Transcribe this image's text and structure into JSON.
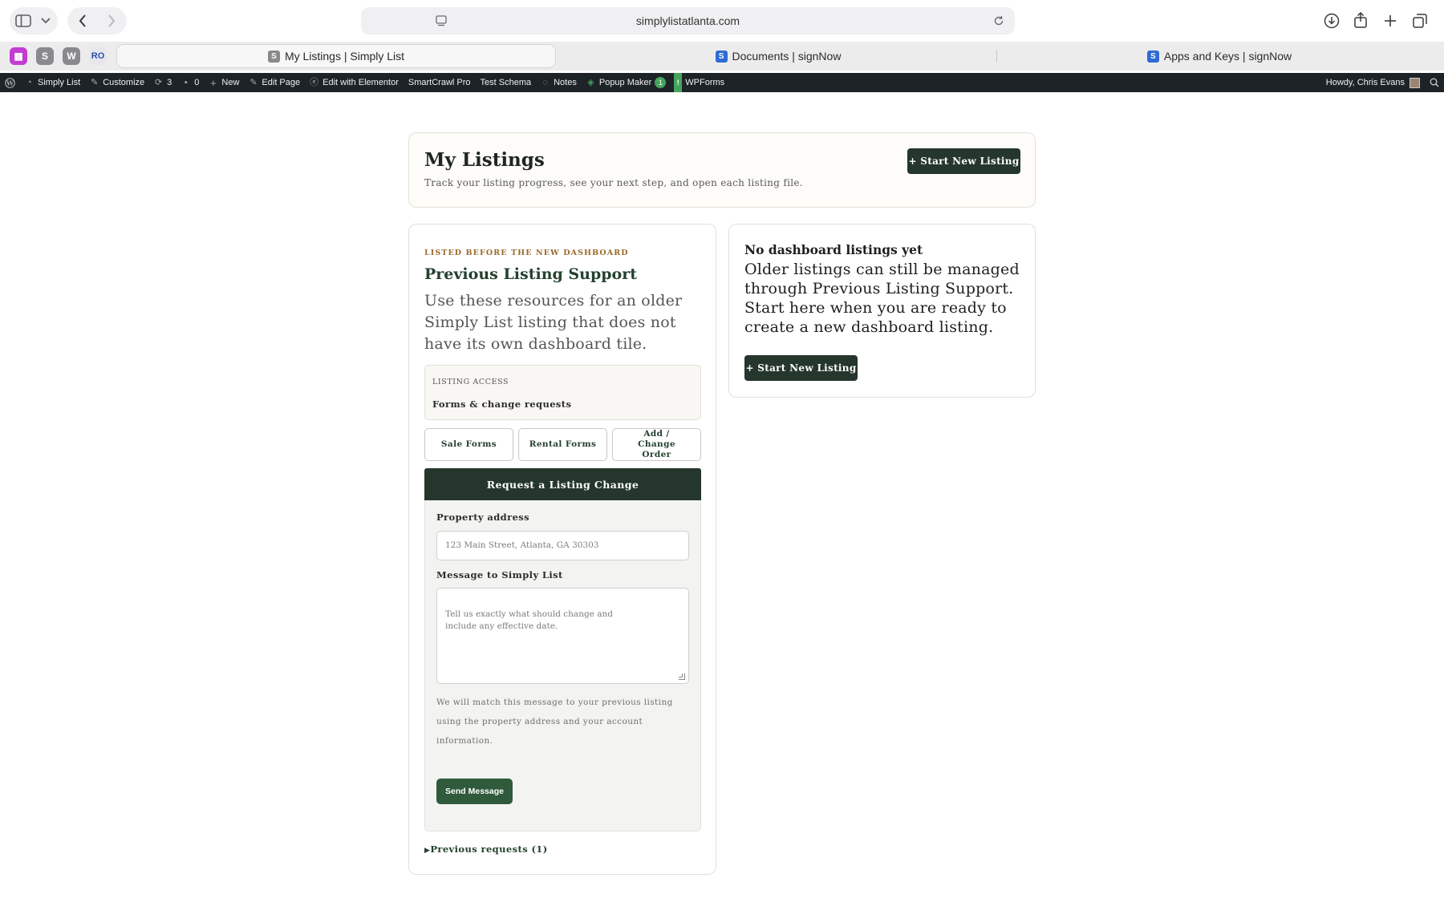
{
  "browser": {
    "url": "simplylistatlanta.com",
    "tabs": [
      {
        "label": "My Listings | Simply List",
        "favicon": "S",
        "active": true
      },
      {
        "label": "Documents | signNow",
        "favicon": "S",
        "active": false
      },
      {
        "label": "Apps and Keys | signNow",
        "favicon": "S",
        "active": false
      }
    ],
    "pinned": [
      "S",
      "W",
      "RO"
    ]
  },
  "adminbar": {
    "site_name": "Simply List",
    "customize": "Customize",
    "updates_count": "3",
    "comments_count": "0",
    "new": "New",
    "edit_page": "Edit Page",
    "edit_elementor": "Edit with Elementor",
    "smartcrawl": "SmartCrawl Pro",
    "test_schema": "Test Schema",
    "notes": "Notes",
    "popup_maker": "Popup Maker",
    "popup_badge": "1",
    "wpforms_badge": "!",
    "wpforms": "WPForms",
    "howdy": "Howdy, Chris Evans"
  },
  "header": {
    "title": "My Listings",
    "subtitle": "Track your listing progress, see your next step, and open each listing file.",
    "start_button": "+ Start New Listing"
  },
  "support": {
    "eyebrow": "LISTED BEFORE THE NEW DASHBOARD",
    "title": "Previous Listing Support",
    "description": "Use these resources for an older Simply List listing that does not have its own dashboard tile.",
    "access_label": "LISTING ACCESS",
    "access_value": "Forms & change requests",
    "buttons": {
      "sale": "Sale Forms",
      "rental": "Rental Forms",
      "change_order": "Add / Change Order"
    },
    "form": {
      "header": "Request a Listing Change",
      "address_label": "Property address",
      "address_placeholder": "123 Main Street, Atlanta, GA 30303",
      "message_label": "Message to Simply List",
      "message_placeholder": "Tell us exactly what should change and\ninclude any effective date.",
      "help_text": "We will match this message to your previous listing using the property address and your account information.",
      "send_button": "Send Message"
    },
    "previous_requests": "Previous requests (1)"
  },
  "empty_state": {
    "title": "No dashboard listings yet",
    "description": "Older listings can still be managed through Previous Listing Support. Start here when you are ready to create a new dashboard listing.",
    "button": "+ Start New Listing"
  },
  "colors": {
    "brand_dark": "#25362c",
    "brand_green": "#2f5a3c",
    "eyebrow": "#9a6a2a",
    "adminbar": "#1d2327"
  }
}
